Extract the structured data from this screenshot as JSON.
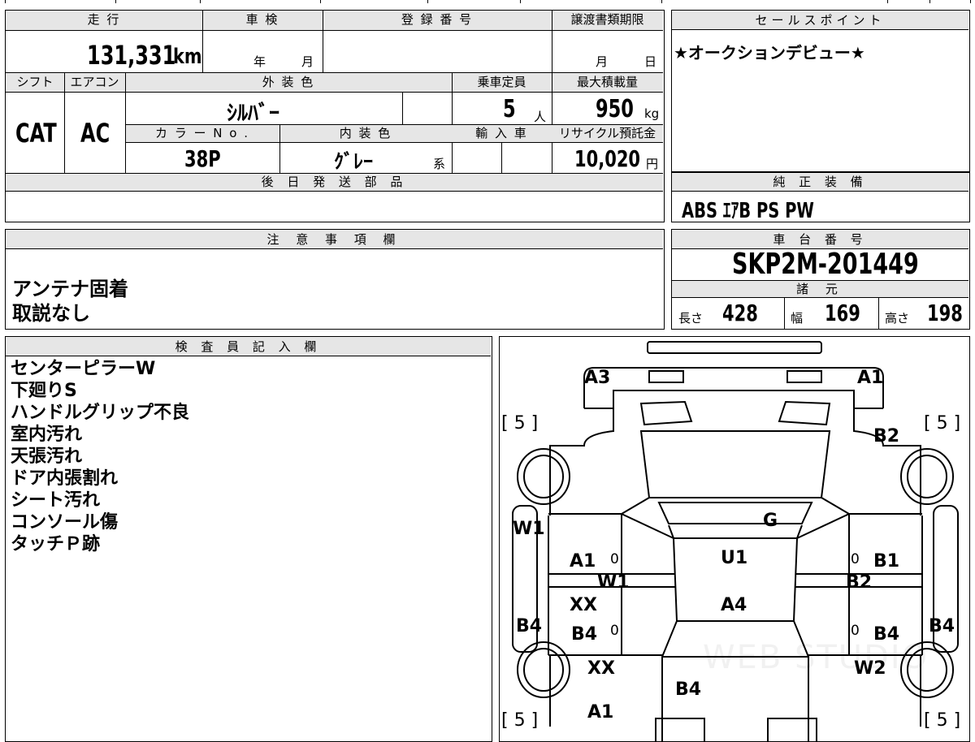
{
  "left_panel": {
    "labels": {
      "mileage": "走 行",
      "inspection": "車 検",
      "registration": "登 録 番 号",
      "transfer_deadline": "譲渡書類期限",
      "shift": "シフト",
      "aircon": "エアコン",
      "exterior_color": "外 装 色",
      "capacity": "乗車定員",
      "max_load": "最大積載量",
      "color_no": "カ ラ ー N o .",
      "interior_color": "内 装 色",
      "import": "輸 入 車",
      "recycle": "リサイクル預託金",
      "later_parts": "後 日 発 送 部 品"
    },
    "values": {
      "mileage": "131,331",
      "mileage_unit": "km",
      "year_unit": "年",
      "month_unit": "月",
      "deadline_month": "月",
      "deadline_day": "日",
      "shift": "CAT",
      "aircon": "AC",
      "exterior_color": "ｼﾙﾊﾞｰ",
      "capacity": "5",
      "capacity_unit": "人",
      "max_load": "950",
      "max_load_unit": "kg",
      "color_no": "38P",
      "interior_color": "ｸﾞﾚｰ",
      "interior_suffix": "系",
      "recycle": "10,020",
      "recycle_unit": "円"
    }
  },
  "sales_point": {
    "label": "セールスポイント",
    "text": "★オークションデビュー★"
  },
  "standard_equipment": {
    "label": "純 正 装 備",
    "text": "ABS ｴｱB PS PW"
  },
  "notes": {
    "label": "注 意 事 項 欄",
    "lines": [
      "アンテナ固着",
      "取説なし"
    ]
  },
  "chassis": {
    "label": "車 台 番 号",
    "number": "SKP2M-201449"
  },
  "specs": {
    "label": "諸 元",
    "length_label": "長さ",
    "length": "428",
    "width_label": "幅",
    "width": "169",
    "height_label": "高さ",
    "height": "198"
  },
  "inspector": {
    "label": "検 査 員 記 入 欄",
    "lines": [
      "センターピラーW",
      "下廻りS",
      "ハンドルグリップ不良",
      "室内汚れ",
      "天張汚れ",
      "ドア内張割れ",
      "シート汚れ",
      "コンソール傷",
      "タッチＰ跡"
    ]
  },
  "diagram": {
    "marks": {
      "a3_top": "A3",
      "a1_top": "A1",
      "b2_right": "B2",
      "g": "G",
      "u1": "U1",
      "a4": "A4",
      "w1_left": "W1",
      "a1_left": "A1",
      "w1_inner": "W1",
      "xx_upper": "XX",
      "b4_left_outer": "B4",
      "b4_left_inner": "B4",
      "xx_lower": "XX",
      "b4_center": "B4",
      "a1_bottom": "A1",
      "b1_right": "B1",
      "b2_inner": "B2",
      "b4_right_inner": "B4",
      "b4_right_outer": "B4",
      "w2_right": "W2",
      "zero_1": "0",
      "zero_2": "0",
      "zero_3": "0",
      "zero_4": "0"
    },
    "tires": {
      "front_left": "[ 5 ]",
      "front_right": "[ 5 ]",
      "rear_left": "[ 5 ]",
      "rear_right": "[ 5 ]"
    },
    "watermark": "WEB STUDIO"
  }
}
